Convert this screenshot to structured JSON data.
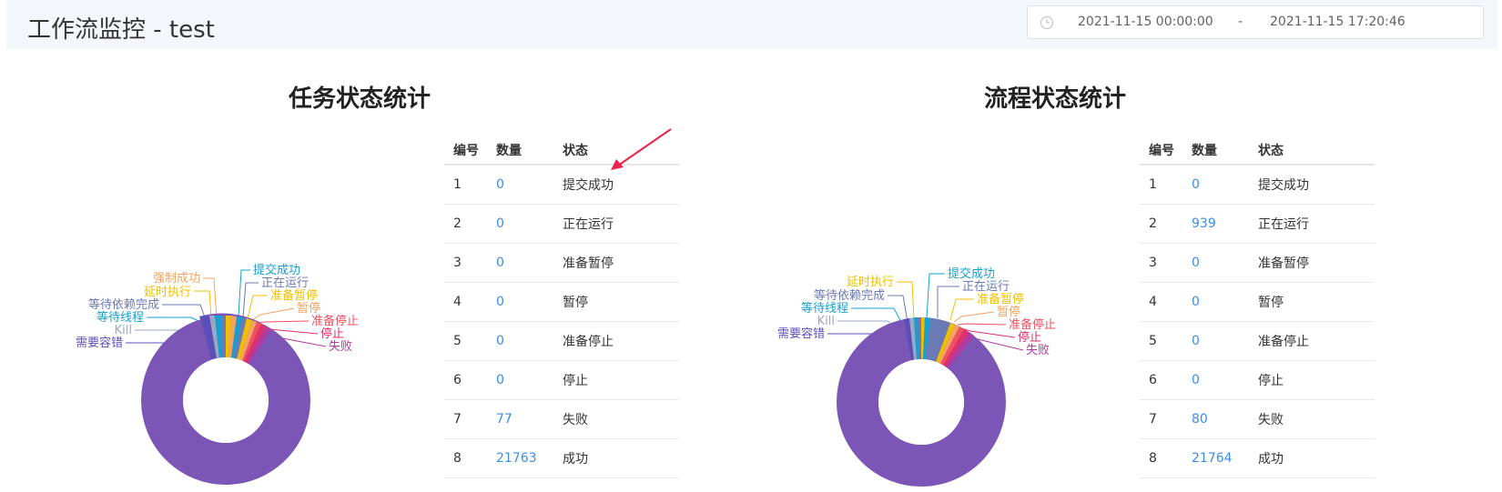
{
  "header": {
    "title": "工作流监控 - test",
    "date_start": "2021-11-15 00:00:00",
    "date_sep": "-",
    "date_end": "2021-11-15 17:20:46"
  },
  "task_panel": {
    "title": "任务状态统计",
    "columns": [
      "编号",
      "数量",
      "状态"
    ],
    "rows": [
      {
        "id": "1",
        "count": "0",
        "state": "提交成功"
      },
      {
        "id": "2",
        "count": "0",
        "state": "正在运行"
      },
      {
        "id": "3",
        "count": "0",
        "state": "准备暂停"
      },
      {
        "id": "4",
        "count": "0",
        "state": "暂停"
      },
      {
        "id": "5",
        "count": "0",
        "state": "准备停止"
      },
      {
        "id": "6",
        "count": "0",
        "state": "停止"
      },
      {
        "id": "7",
        "count": "77",
        "state": "失败"
      },
      {
        "id": "8",
        "count": "21763",
        "state": "成功"
      }
    ],
    "chart_labels_right": [
      "提交成功",
      "正在运行",
      "准备暂停",
      "暂停",
      "准备停止",
      "停止",
      "失败"
    ],
    "chart_labels_left": [
      "强制成功",
      "延时执行",
      "等待依赖完成",
      "等待线程",
      "Kill",
      "需要容错"
    ]
  },
  "process_panel": {
    "title": "流程状态统计",
    "columns": [
      "编号",
      "数量",
      "状态"
    ],
    "rows": [
      {
        "id": "1",
        "count": "0",
        "state": "提交成功"
      },
      {
        "id": "2",
        "count": "939",
        "state": "正在运行"
      },
      {
        "id": "3",
        "count": "0",
        "state": "准备暂停"
      },
      {
        "id": "4",
        "count": "0",
        "state": "暂停"
      },
      {
        "id": "5",
        "count": "0",
        "state": "准备停止"
      },
      {
        "id": "6",
        "count": "0",
        "state": "停止"
      },
      {
        "id": "7",
        "count": "80",
        "state": "失败"
      },
      {
        "id": "8",
        "count": "21764",
        "state": "成功"
      }
    ],
    "chart_labels_right": [
      "提交成功",
      "正在运行",
      "准备暂停",
      "暂停",
      "准备停止",
      "停止",
      "失败"
    ],
    "chart_labels_left": [
      "延时执行",
      "等待依赖完成",
      "等待线程",
      "Kill",
      "需要容错"
    ]
  },
  "colors": {
    "success": "#7b56b6",
    "accent_number": "#3a8ee6",
    "arrow": "#e8254a"
  }
}
